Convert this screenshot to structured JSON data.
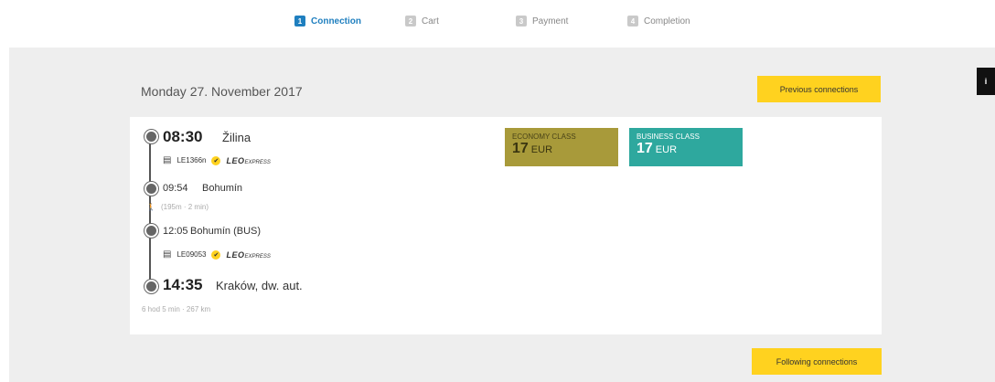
{
  "stepper": {
    "steps": [
      {
        "num": "1",
        "label": "Connection",
        "active": true
      },
      {
        "num": "2",
        "label": "Cart",
        "active": false
      },
      {
        "num": "3",
        "label": "Payment",
        "active": false
      },
      {
        "num": "4",
        "label": "Completion",
        "active": false
      }
    ]
  },
  "info_tab": "i",
  "search": {
    "date": "Monday 27. November 2017",
    "previous_label": "Previous connections",
    "following_label": "Following connections"
  },
  "connection": {
    "departure": {
      "time": "08:30",
      "station": "Žilina"
    },
    "leg1": {
      "train": "LE1366n",
      "brand": "LEO",
      "brand_sub": "EXPRESS"
    },
    "transfer_arrival": {
      "time": "09:54",
      "station": "Bohumín"
    },
    "transfer_info": "(195m · 2 min)",
    "transfer_departure": {
      "time": "12:05",
      "station": "Bohumín (BUS)"
    },
    "leg2": {
      "train": "LE09053",
      "brand": "LEO",
      "brand_sub": "EXPRESS"
    },
    "arrival": {
      "time": "14:35",
      "station": "Kraków, dw. aut."
    },
    "duration": "6 hod 5 min · 267 km",
    "fares": [
      {
        "class": "ECONOMY CLASS",
        "price": "17",
        "currency": "EUR",
        "color": "#a89a3a"
      },
      {
        "class": "BUSINESS CLASS",
        "price": "17",
        "currency": "EUR",
        "color": "#2ea89e"
      }
    ]
  },
  "colors": {
    "accent": "#1f7fbf",
    "button": "#ffd21f",
    "panel": "#eeeeee"
  }
}
